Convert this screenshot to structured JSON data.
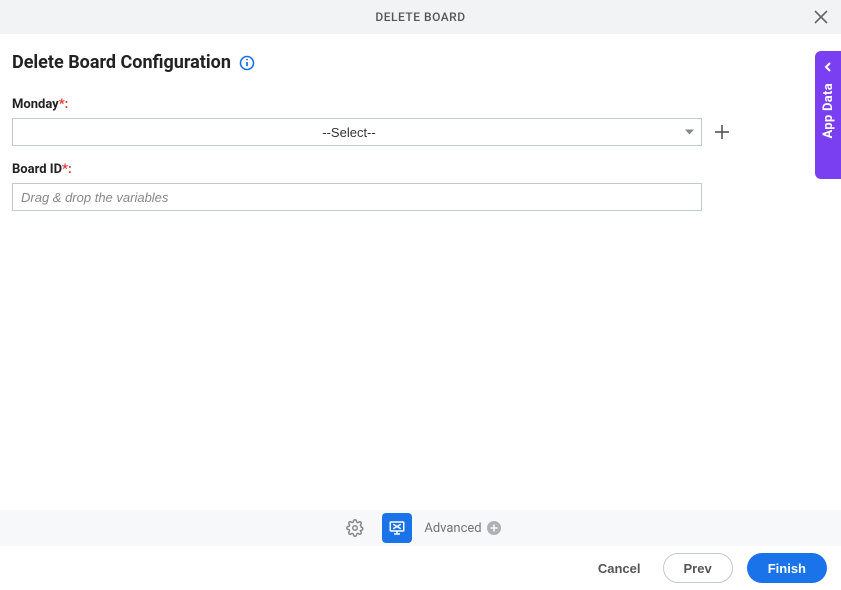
{
  "header": {
    "title": "DELETE BOARD"
  },
  "page": {
    "title": "Delete Board Configuration"
  },
  "fields": {
    "monday": {
      "label": "Monday",
      "required_suffix": "*:",
      "value": "--Select--"
    },
    "board_id": {
      "label": "Board ID",
      "required_suffix": "*:",
      "placeholder": "Drag & drop the variables"
    }
  },
  "bottom_bar": {
    "advanced_label": "Advanced"
  },
  "footer": {
    "cancel": "Cancel",
    "prev": "Prev",
    "finish": "Finish"
  },
  "side_tab": {
    "label": "App Data"
  }
}
